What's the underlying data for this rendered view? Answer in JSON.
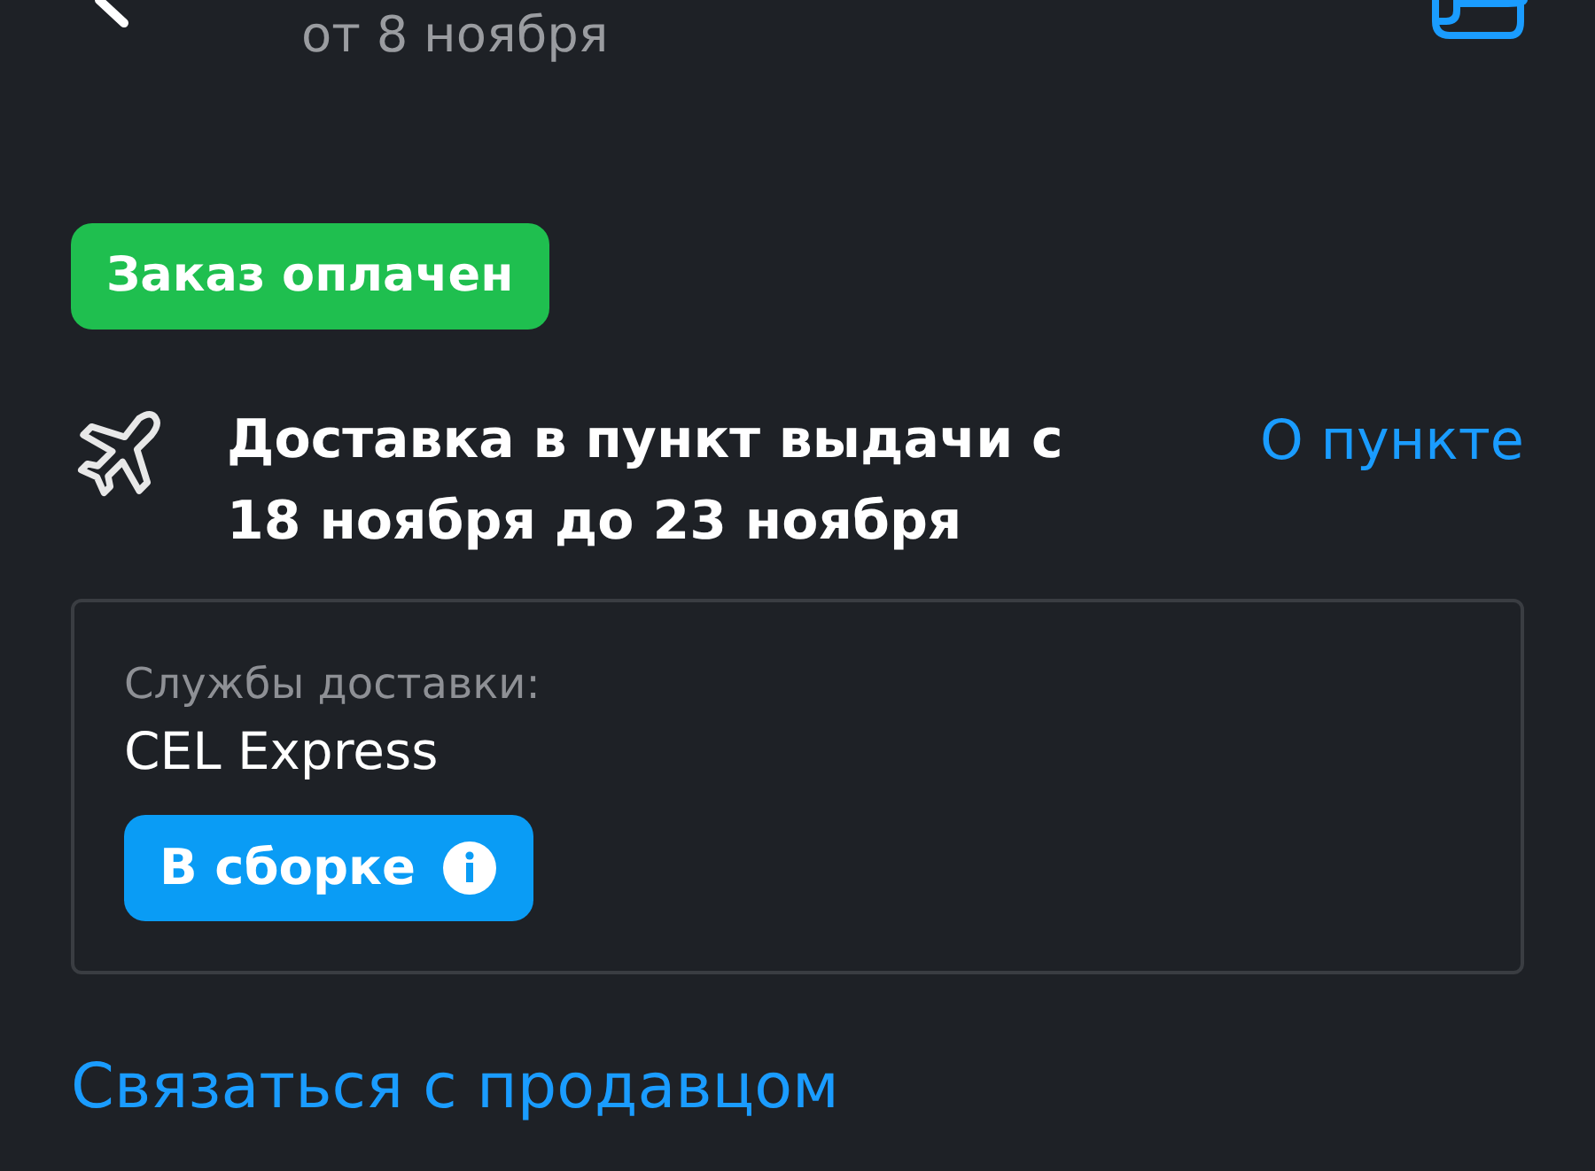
{
  "header": {
    "subtitle": "от 8 ноября"
  },
  "status_badge": "Заказ оплачен",
  "delivery": {
    "text": "Доставка в пункт выдачи с 18 ноября до 23 ноября",
    "link": "О пункте"
  },
  "delivery_card": {
    "label": "Службы доставки:",
    "service": "CEL Express",
    "status_button": "В сборке"
  },
  "contact_link": "Связаться с продавцом"
}
